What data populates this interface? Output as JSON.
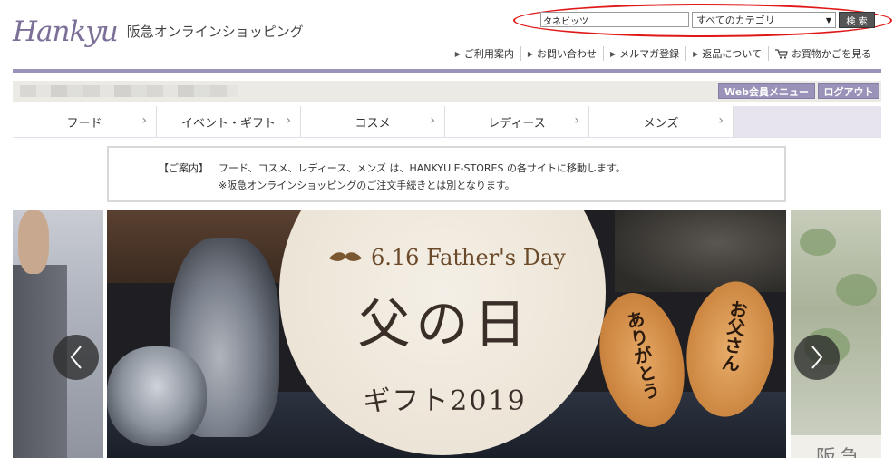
{
  "header": {
    "logo_mark": "Hankyu",
    "logo_text": "阪急オンラインショッピング"
  },
  "search": {
    "value": "タネビッツ",
    "category_selected": "すべてのカテゴリ",
    "button_label": "検 索"
  },
  "util_links": [
    {
      "label": "ご利用案内"
    },
    {
      "label": "お問い合わせ"
    },
    {
      "label": "メルマガ登録"
    },
    {
      "label": "返品について"
    },
    {
      "label": "お買物かごを見る",
      "icon": "cart-icon"
    }
  ],
  "member": {
    "menu_label": "Web会員メニュー",
    "logout_label": "ログアウト"
  },
  "categories": [
    {
      "label": "フード"
    },
    {
      "label": "イベント・ギフト"
    },
    {
      "label": "コスメ"
    },
    {
      "label": "レディース"
    },
    {
      "label": "メンズ"
    }
  ],
  "notice": {
    "label": "【ご案内】",
    "line1": "フード、コスメ、レディース、メンズ は、HANKYU E-STORES の各サイトに移動します。",
    "line2": "※阪急オンラインショッピングのご注文手続きとは別となります。"
  },
  "banner": {
    "fathers_day": "6.16 Father's Day",
    "title": "父の日",
    "subtitle": "ギフト2019",
    "cracker1_text": "ありがとう",
    "cracker2_text": "お父さん"
  },
  "side_banner_right_caption": "阪急",
  "colors": {
    "brand_purple": "#9a92b8",
    "highlight_red": "#e01818"
  }
}
